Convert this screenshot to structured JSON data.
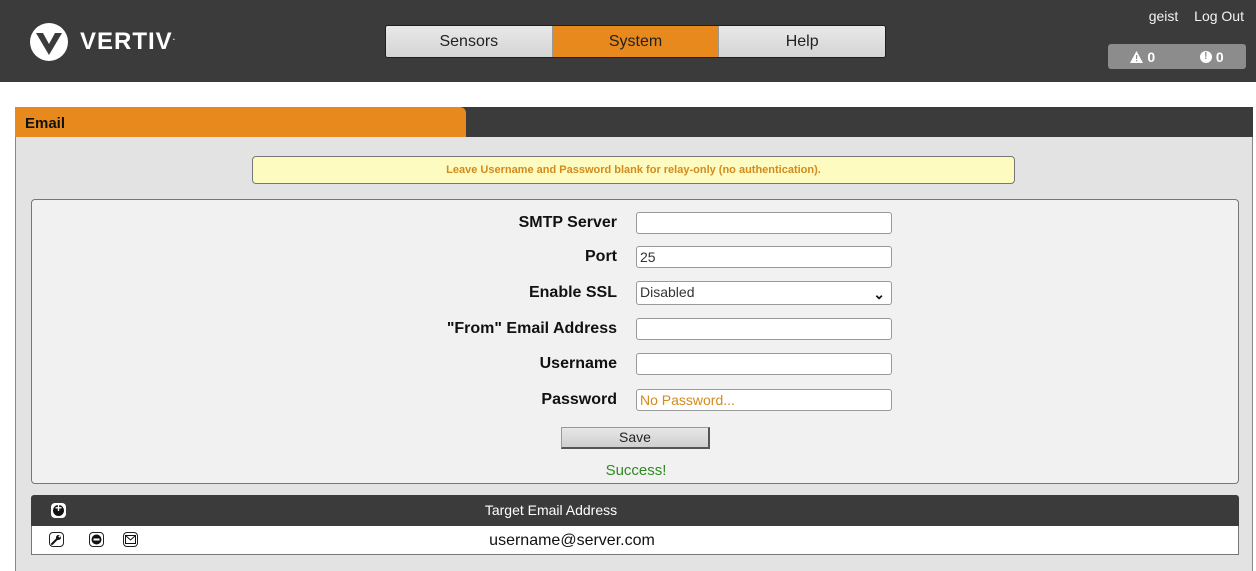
{
  "brand": {
    "name": "VERTIV",
    "trademark": "."
  },
  "nav": {
    "tabs": [
      "Sensors",
      "System",
      "Help"
    ],
    "active": "System"
  },
  "user": {
    "name": "geist",
    "logout": "Log Out"
  },
  "alerts": {
    "warnings": "0",
    "alarms": "0"
  },
  "panel": {
    "title": "Email"
  },
  "notice": "Leave Username and Password blank for relay-only (no authentication).",
  "form": {
    "smtp_server": {
      "label": "SMTP Server",
      "value": ""
    },
    "port": {
      "label": "Port",
      "value": "25"
    },
    "enable_ssl": {
      "label": "Enable SSL",
      "value": "Disabled"
    },
    "from_email": {
      "label": "\"From\" Email Address",
      "value": ""
    },
    "username": {
      "label": "Username",
      "value": ""
    },
    "password": {
      "label": "Password",
      "placeholder": "No Password..."
    },
    "save_label": "Save",
    "status": "Success!"
  },
  "targets": {
    "header": "Target Email Address",
    "rows": [
      {
        "address": "username@server.com"
      }
    ]
  },
  "colors": {
    "accent": "#e8891d",
    "bar": "#3b3b3b",
    "success": "#2e8b1f"
  }
}
